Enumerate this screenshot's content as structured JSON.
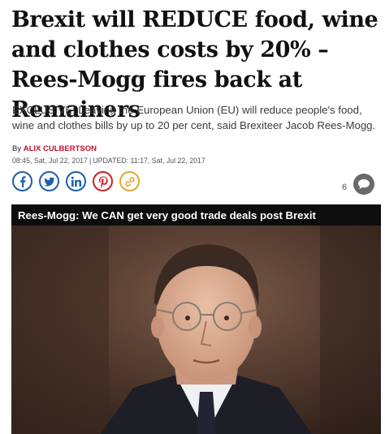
{
  "article": {
    "headline": "Brexit will REDUCE food, wine and clothes costs by 20% – Rees-Mogg fires back at Remainers",
    "standfirst": "EXCLUSIVE: Leaving the European Union (EU) will reduce people's food, wine and clothes bills by up to 20 per cent, said Brexiteer Jacob Rees-Mogg.",
    "byline_prefix": "By",
    "author": "ALIX CULBERTSON",
    "published": "08:45, Sat, Jul 22, 2017",
    "separator": "|",
    "updated": "UPDATED: 11:17, Sat, Jul 22, 2017"
  },
  "share": {
    "icons": [
      "facebook-icon",
      "twitter-icon",
      "linkedin-icon",
      "pinterest-icon",
      "link-icon"
    ],
    "brand_blue": "#1f5fa8",
    "pinterest_red": "#cc2127",
    "link_yellow": "#e3a72f"
  },
  "comments": {
    "count": "6",
    "icon": "comment-bubble-icon"
  },
  "media": {
    "caption": "Rees-Mogg: We CAN get very good trade deals post Brexit",
    "image": "photo of man in glasses and suit"
  },
  "colors": {
    "author_red": "#c8102e",
    "caption_bar": "#0d0d0d"
  }
}
